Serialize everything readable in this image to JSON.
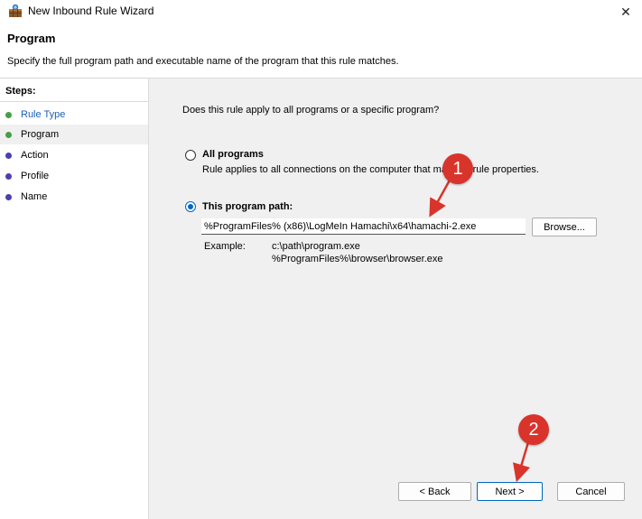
{
  "window": {
    "title": "New Inbound Rule Wizard",
    "close_glyph": "✕"
  },
  "header": {
    "title": "Program",
    "description": "Specify the full program path and executable name of the program that this rule matches."
  },
  "sidebar": {
    "steps_label": "Steps:",
    "items": [
      {
        "label": "Rule Type",
        "dot_color": "#43a047",
        "state": "completed"
      },
      {
        "label": "Program",
        "dot_color": "#43a047",
        "state": "current"
      },
      {
        "label": "Action",
        "dot_color": "#4a3fb0",
        "state": "pending"
      },
      {
        "label": "Profile",
        "dot_color": "#4a3fb0",
        "state": "pending"
      },
      {
        "label": "Name",
        "dot_color": "#4a3fb0",
        "state": "pending"
      }
    ]
  },
  "main": {
    "question": "Does this rule apply to all programs or a specific program?",
    "all_programs": {
      "label": "All programs",
      "desc_before": "Rule applies to all connections on the computer that ma",
      "desc_after": "r rule properties.",
      "selected": false
    },
    "program_path": {
      "label": "This program path:",
      "selected": true,
      "value": "%ProgramFiles% (x86)\\LogMeIn Hamachi\\x64\\hamachi-2.exe"
    },
    "browse_label": "Browse...",
    "example_key": "Example:",
    "example_lines": [
      "c:\\path\\program.exe",
      "%ProgramFiles%\\browser\\browser.exe"
    ]
  },
  "footer": {
    "back_label": "< Back",
    "next_label": "Next >",
    "cancel_label": "Cancel"
  },
  "annotations": {
    "badge_1": "1",
    "badge_2": "2",
    "color": "#d9342b"
  },
  "icons": {
    "app_icon": "firewall-wizard-icon",
    "close_icon": "close-icon"
  }
}
